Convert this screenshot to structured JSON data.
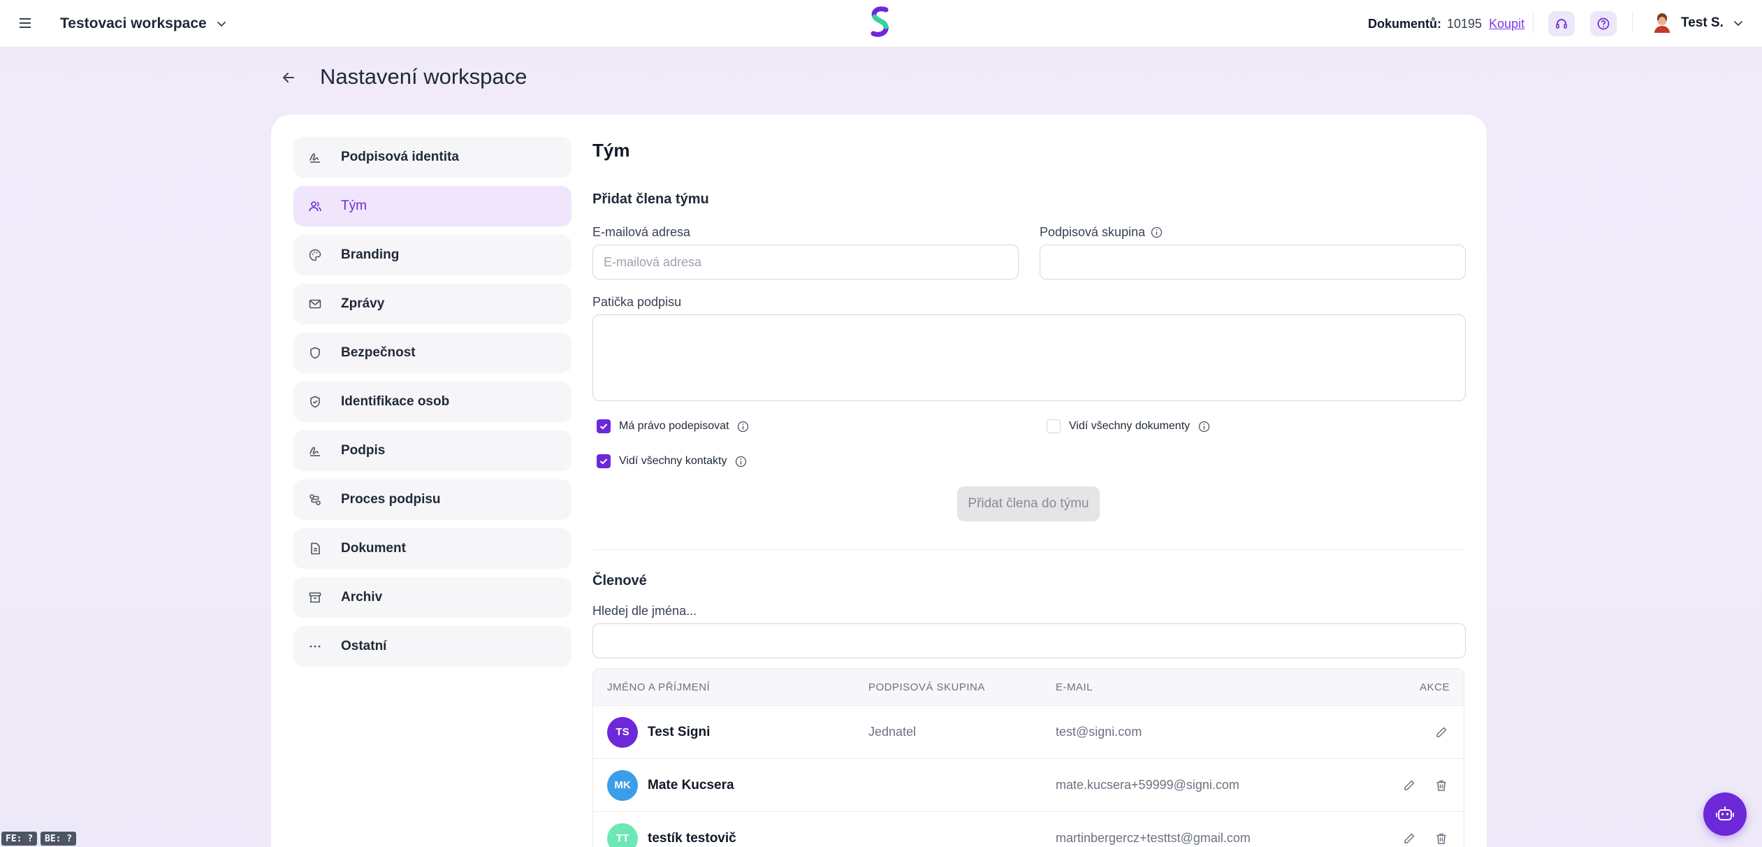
{
  "topbar": {
    "workspace_name": "Testovaci workspace",
    "documents_label": "Dokumentů:",
    "documents_count": "10195",
    "buy_label": "Koupit",
    "user_name": "Test S.",
    "icons": {
      "menu": "hamburger-icon",
      "support": "headset-icon",
      "help": "question-circle-icon",
      "dropdown": "chevron-down-icon"
    }
  },
  "page": {
    "title": "Nastavení workspace"
  },
  "nav": {
    "items": [
      {
        "label": "Podpisová identita",
        "icon": "signature-icon",
        "active": false
      },
      {
        "label": "Tým",
        "icon": "users-icon",
        "active": true
      },
      {
        "label": "Branding",
        "icon": "palette-icon",
        "active": false
      },
      {
        "label": "Zprávy",
        "icon": "mail-icon",
        "active": false
      },
      {
        "label": "Bezpečnost",
        "icon": "shield-icon",
        "active": false
      },
      {
        "label": "Identifikace osob",
        "icon": "shield-check-icon",
        "active": false
      },
      {
        "label": "Podpis",
        "icon": "signature-icon",
        "active": false
      },
      {
        "label": "Proces podpisu",
        "icon": "workflow-icon",
        "active": false
      },
      {
        "label": "Dokument",
        "icon": "document-icon",
        "active": false
      },
      {
        "label": "Archiv",
        "icon": "archive-icon",
        "active": false
      },
      {
        "label": "Ostatní",
        "icon": "more-icon",
        "active": false
      }
    ]
  },
  "team": {
    "title": "Tým",
    "add_section": {
      "title": "Přidat člena týmu",
      "email_label": "E-mailová adresa",
      "email_placeholder": "E-mailová adresa",
      "group_label": "Podpisová skupina",
      "footer_label": "Patička podpisu",
      "checkboxes": [
        {
          "label": "Má právo podepisovat",
          "checked": true
        },
        {
          "label": "Vidí všechny dokumenty",
          "checked": false
        },
        {
          "label": "Vidí všechny kontakty",
          "checked": true
        }
      ],
      "submit_label": "Přidat člena do týmu"
    },
    "members": {
      "title": "Členové",
      "search_label": "Hledej dle jména...",
      "columns": [
        "JMÉNO A PŘÍJMENÍ",
        "PODPISOVÁ SKUPINA",
        "E-MAIL",
        "AKCE"
      ],
      "rows": [
        {
          "initials": "TS",
          "name": "Test Signi",
          "group": "Jednatel",
          "email": "test@signi.com",
          "avatar_color": "#6d28d9",
          "deletable": false
        },
        {
          "initials": "MK",
          "name": "Mate Kucsera",
          "group": "",
          "email": "mate.kucsera+59999@signi.com",
          "avatar_color": "#3b9ee8",
          "deletable": true
        },
        {
          "initials": "TT",
          "name": "testík testovič",
          "group": "",
          "email": "martinbergercz+testtst@gmail.com",
          "avatar_color": "#6ee7b7",
          "deletable": true
        }
      ]
    }
  },
  "debug": {
    "fe": "FE: ?",
    "be": "BE: ?"
  },
  "colors": {
    "accent": "#6d28d9",
    "active_nav_bg": "#efe6fb",
    "page_bg": "#efe9f9"
  }
}
